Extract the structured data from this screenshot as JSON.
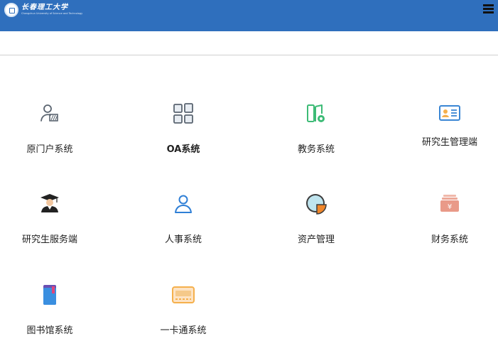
{
  "header": {
    "logo_cn": "长春理工大学",
    "logo_en": "Changchun University of Science and Technology",
    "brand_color": "#2f6fbd",
    "menu_icon": "hamburger-menu-icon"
  },
  "systems": [
    {
      "label": "原门户系统",
      "icon": "portal-user-icon",
      "color": "#5a6470"
    },
    {
      "label": "OA系统",
      "icon": "grid-windows-icon",
      "color": "#5a6470"
    },
    {
      "label": "教务系统",
      "icon": "book-gear-icon",
      "color": "#3dbb76"
    },
    {
      "label": "研究生管理端",
      "icon": "id-card-icon",
      "color": "#3a86d4"
    },
    {
      "label": "研究生服务端",
      "icon": "graduate-cap-icon",
      "color": "#222222"
    },
    {
      "label": "人事系统",
      "icon": "person-outline-icon",
      "color": "#2f7fd6"
    },
    {
      "label": "资产管理",
      "icon": "pie-chart-icon",
      "color": "#f0862a"
    },
    {
      "label": "财务系统",
      "icon": "yuan-wallet-icon",
      "color": "#e99a88"
    },
    {
      "label": "图书馆系统",
      "icon": "book-bookmark-icon",
      "color": "#3a8fe0"
    },
    {
      "label": "一卡通系统",
      "icon": "campus-card-icon",
      "color": "#f5b04c"
    }
  ]
}
